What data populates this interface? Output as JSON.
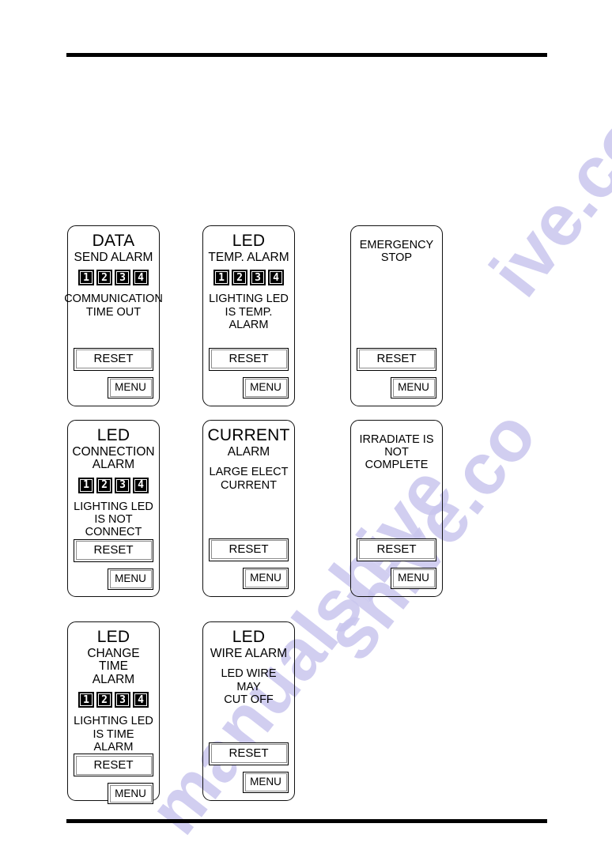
{
  "page": {
    "background_color": "#ffffff",
    "rule_color": "#000000",
    "watermark": {
      "text": "manualshive.com",
      "color": "#c9c6ee",
      "fragments": [
        "ive.com",
        "manualshive",
        "shive.co"
      ]
    }
  },
  "panels": [
    {
      "id": "data-send-alarm",
      "title": "DATA",
      "title_size": "large",
      "subtitle": "SEND ALARM",
      "digits": [
        "1",
        "2",
        "3",
        "4"
      ],
      "message": "COMMUNICATION\nTIME OUT",
      "reset_label": "RESET",
      "menu_label": "MENU"
    },
    {
      "id": "led-temp-alarm",
      "title": "LED",
      "title_size": "large",
      "subtitle": "TEMP. ALARM",
      "digits": [
        "1",
        "2",
        "3",
        "4"
      ],
      "message": "LIGHTING LED\nIS TEMP.\nALARM",
      "reset_label": "RESET",
      "menu_label": "MENU"
    },
    {
      "id": "emergency-stop",
      "title": "",
      "title_size": "large",
      "subtitle": "",
      "digits": [],
      "message": "EMERGENCY\nSTOP",
      "reset_label": "RESET",
      "menu_label": "MENU"
    },
    {
      "id": "led-connection-alarm",
      "title": "LED",
      "title_size": "large",
      "subtitle": "CONNECTION\nALARM",
      "digits": [
        "1",
        "2",
        "3",
        "4"
      ],
      "message": "LIGHTING LED\nIS NOT\nCONNECT",
      "reset_label": "RESET",
      "menu_label": "MENU"
    },
    {
      "id": "current-alarm",
      "title": "CURRENT",
      "title_size": "large",
      "subtitle": "ALARM",
      "digits": [],
      "message": "LARGE ELECT\nCURRENT",
      "reset_label": "RESET",
      "menu_label": "MENU"
    },
    {
      "id": "irradiate-not-complete",
      "title": "",
      "title_size": "large",
      "subtitle": "",
      "digits": [],
      "message": "IRRADIATE IS\nNOT\nCOMPLETE",
      "reset_label": "RESET",
      "menu_label": "MENU"
    },
    {
      "id": "led-change-time-alarm",
      "title": "LED",
      "title_size": "large",
      "subtitle": "CHANGE TIME\nALARM",
      "digits": [
        "1",
        "2",
        "3",
        "4"
      ],
      "message": "LIGHTING LED\nIS TIME\nALARM",
      "reset_label": "RESET",
      "menu_label": "MENU"
    },
    {
      "id": "led-wire-alarm",
      "title": "LED",
      "title_size": "large",
      "subtitle": "WIRE ALARM",
      "digits": [],
      "message": "LED WIRE MAY\nCUT OFF",
      "reset_label": "RESET",
      "menu_label": "MENU"
    }
  ]
}
